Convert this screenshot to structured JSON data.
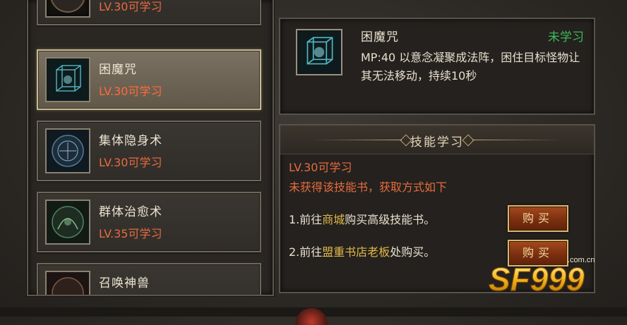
{
  "skill_list": [
    {
      "name": "",
      "level": "LV.30可学习",
      "selected": false
    },
    {
      "name": "困魔咒",
      "level": "LV.30可学习",
      "selected": true
    },
    {
      "name": "集体隐身术",
      "level": "LV.30可学习",
      "selected": false
    },
    {
      "name": "群体治愈术",
      "level": "LV.35可学习",
      "selected": false
    },
    {
      "name": "召唤神兽",
      "level": "",
      "selected": false
    }
  ],
  "detail": {
    "name": "困魔咒",
    "status": "未学习",
    "description": "MP:40  以意念凝聚成法阵，困住目标怪物让其无法移动，持续10秒"
  },
  "learn": {
    "title": "技能学习",
    "required_level": "LV.30可学习",
    "note": "未获得该技能书，获取方式如下",
    "way1": {
      "prefix": "1.前往",
      "highlight": "商城",
      "suffix": "购买高级技能书。"
    },
    "way2": {
      "prefix": "2.前往",
      "highlight": "盟重书店老板",
      "suffix": "处购买。"
    },
    "buy_label": "购买"
  },
  "watermark": {
    "main": "SF999",
    "domain": ".com.cn"
  },
  "colors": {
    "level_text": "#e76b3e",
    "not_learned": "#3fb85a",
    "highlight": "#e2b84a",
    "button_border": "#d9b66e"
  }
}
